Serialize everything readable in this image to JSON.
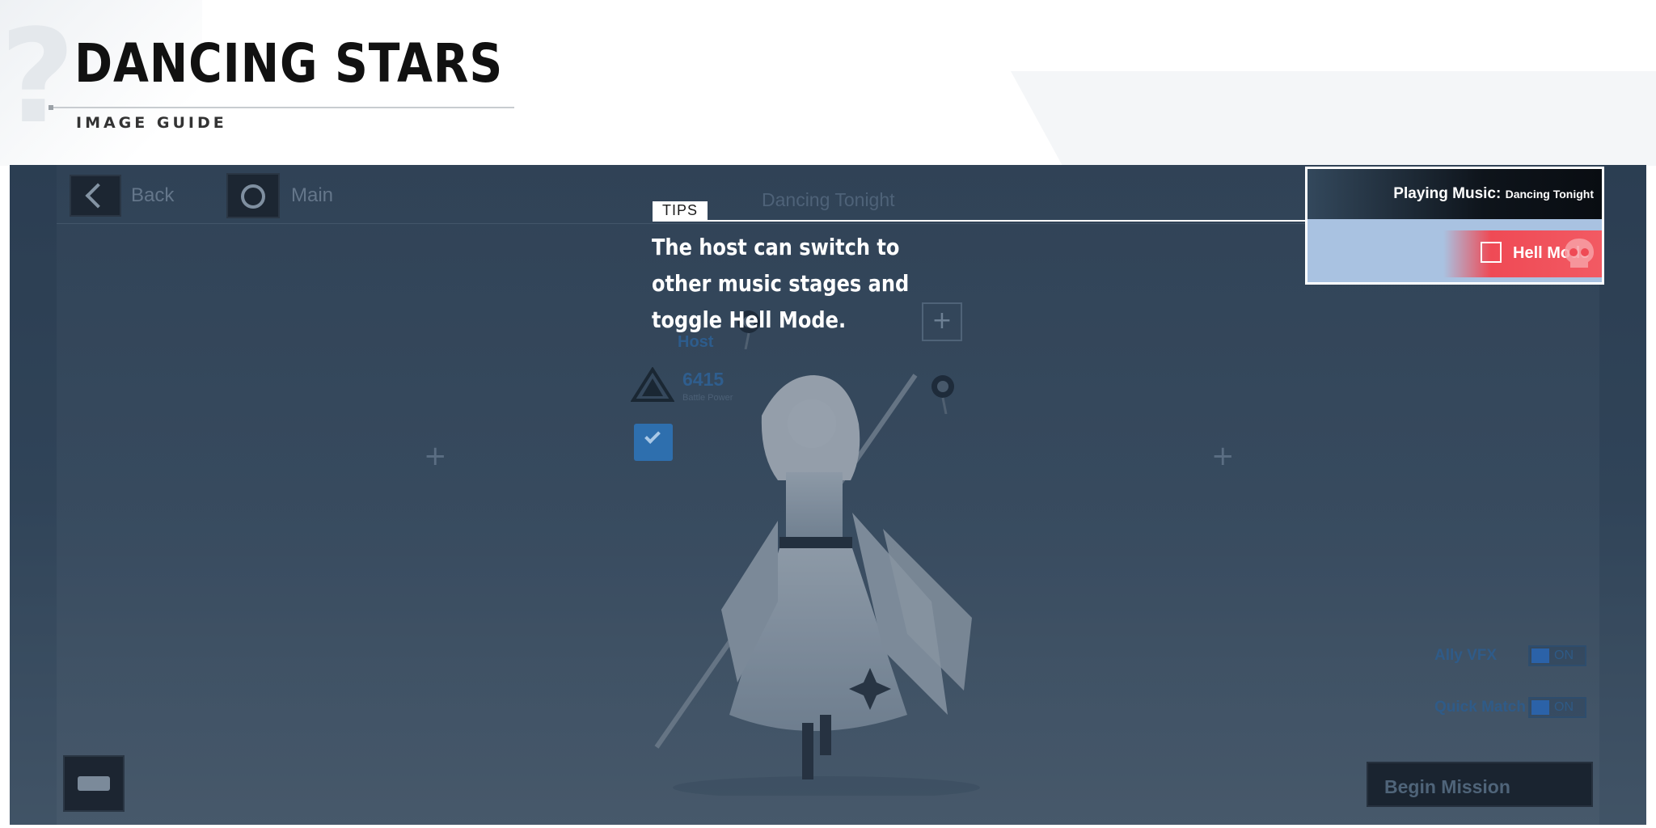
{
  "header": {
    "title": "DANCING STARS",
    "subtitle": "IMAGE GUIDE"
  },
  "topbar": {
    "back_label": "Back",
    "main_label": "Main",
    "stage_name": "Dancing Tonight"
  },
  "tips": {
    "tag": "TIPS",
    "text": "The host can switch to other music stages and toggle Hell Mode."
  },
  "music_panel": {
    "label": "Playing Music:",
    "song": "Dancing Tonight",
    "hell_mode_label": "Hell Mode",
    "hell_mode_checked": false
  },
  "player": {
    "role_label": "Host",
    "battle_power": "6415",
    "battle_power_label": "Battle Power",
    "ready": true
  },
  "settings": {
    "ally_vfx_label": "Ally VFX",
    "ally_vfx_state": "ON",
    "quick_match_label": "Quick Match",
    "quick_match_state": "ON"
  },
  "actions": {
    "begin_label": "Begin Mission"
  },
  "icons": {
    "back": "chevron-left-icon",
    "main": "circle-icon",
    "chat": "chat-bubble-icon",
    "battle_power": "rank-triangle-icon",
    "skull": "skull-icon"
  },
  "colors": {
    "overlay": "#34475b",
    "highlight_panel": "#a9c2e1",
    "hell_mode": "#ef4a55",
    "accent_blue": "#2e6fae"
  }
}
